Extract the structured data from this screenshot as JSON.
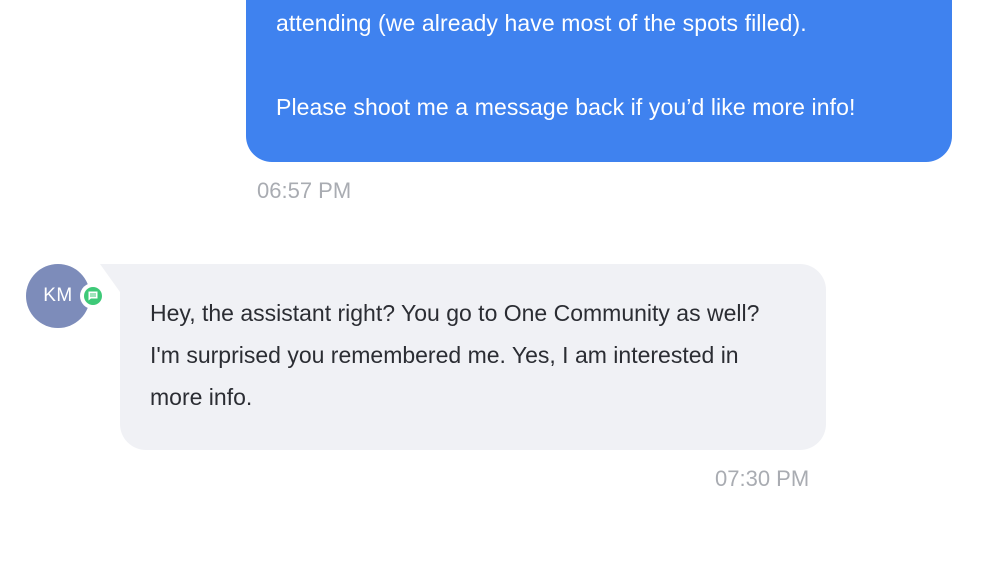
{
  "conversation": {
    "outgoing_message": {
      "lines": [
        "attending (we already have most of the spots filled).",
        "Please shoot me a message back if you’d like more info!"
      ],
      "timestamp": "06:57 PM",
      "bubble_color": "#3f82ef"
    },
    "incoming_message": {
      "sender_initials": "KM",
      "avatar_color": "#7d8cba",
      "channel_icon": "sms-chat-icon",
      "channel_color": "#3ec978",
      "lines": [
        "Hey, the assistant right? You go to One Community as well?",
        "I'm surprised you remembered me. Yes, I am interested in",
        "more info."
      ],
      "timestamp": "07:30 PM",
      "bubble_color": "#f0f1f5"
    }
  }
}
